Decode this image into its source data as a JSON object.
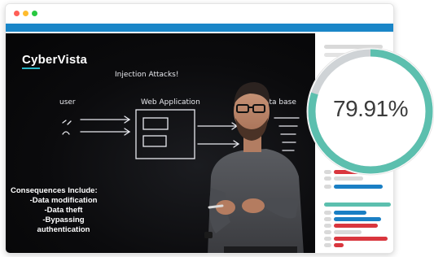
{
  "window": {
    "controls": [
      "close",
      "minimize",
      "zoom"
    ]
  },
  "video": {
    "logo": "CyberVista",
    "board": {
      "title": "Injection Attacks!",
      "user_label": "user",
      "app_label": "Web Application",
      "db_label": "ata base"
    },
    "consequences": {
      "heading": "Consequences Include:",
      "items": [
        "-Data modification",
        "-Data theft",
        "-Bypassing",
        "authentication"
      ]
    }
  },
  "progress": {
    "label": "79.91%",
    "value": 0.7991,
    "color": "#5cbfae",
    "track_color": "#cfd3d6"
  },
  "colors": {
    "accent": "#1a86c8",
    "sidebar_teal": "#5cbfae",
    "sidebar_blue": "#1a7fc4",
    "sidebar_red": "#d9363e",
    "sidebar_gray": "#d9d9d9"
  }
}
